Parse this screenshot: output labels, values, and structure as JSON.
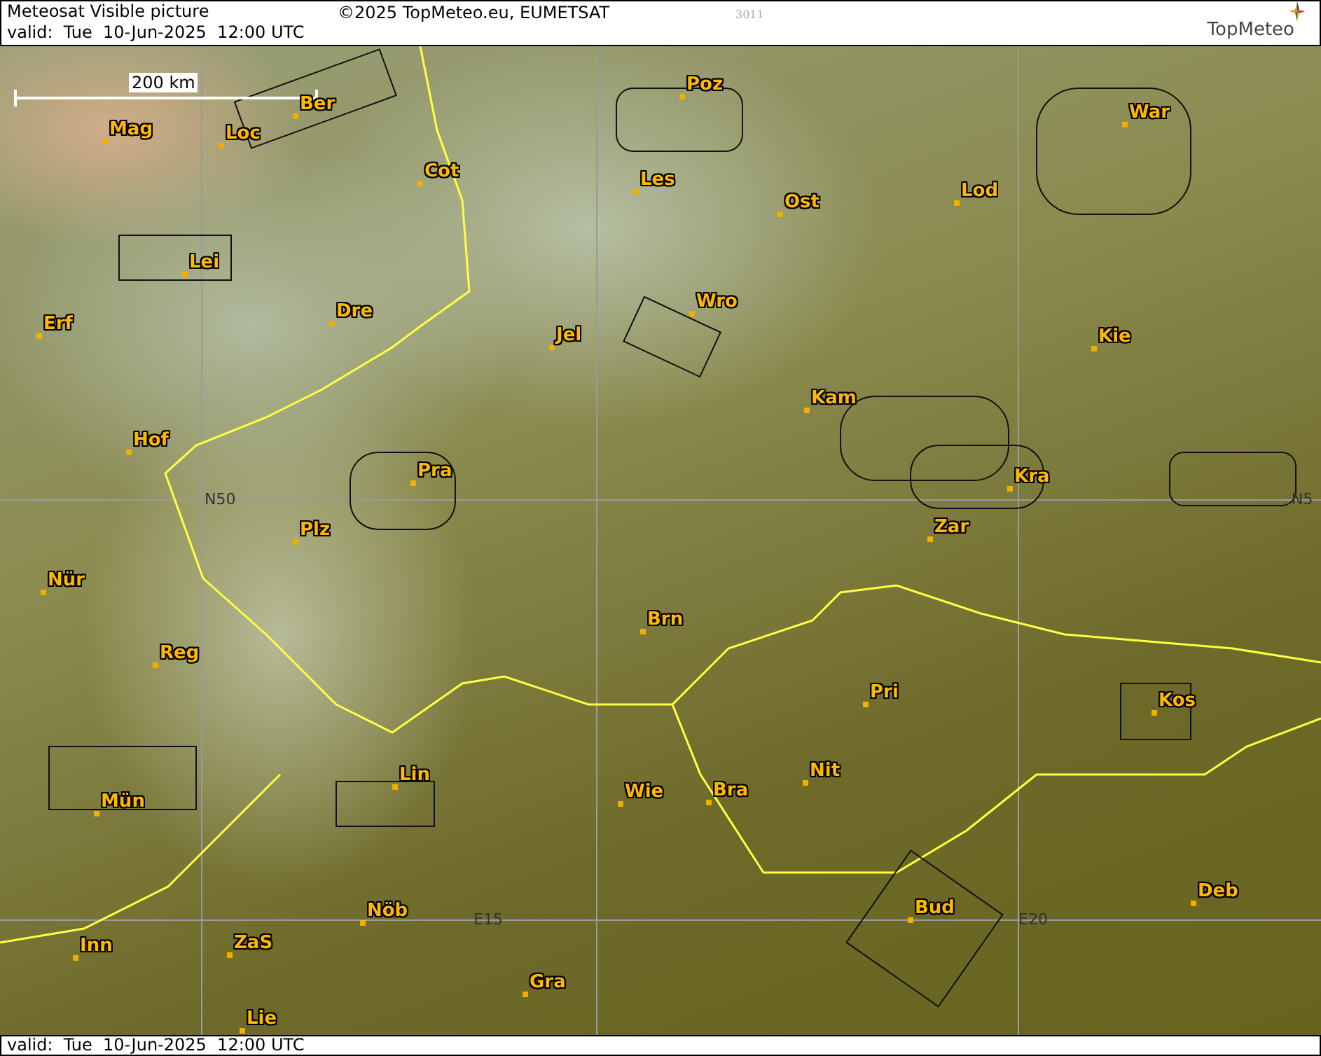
{
  "header": {
    "title": "Meteosat Visible picture",
    "copyright": "©2025 TopMeteo.eu, EUMETSAT",
    "code": "3011",
    "valid": "valid:  Tue  10-Jun-2025  12:00 UTC",
    "logo": "TopMeteo"
  },
  "map": {
    "scale": "200 km",
    "labels": [
      {
        "text": "Ber",
        "kind": "city"
      },
      {
        "text": "Mag",
        "kind": "city"
      },
      {
        "text": "Loc",
        "kind": "city"
      },
      {
        "text": "Cot",
        "kind": "city"
      },
      {
        "text": "Lei",
        "kind": "city"
      },
      {
        "text": "Erf",
        "kind": "city"
      },
      {
        "text": "Dre",
        "kind": "city"
      },
      {
        "text": "Jel",
        "kind": "city"
      },
      {
        "text": "Hof",
        "kind": "city"
      },
      {
        "text": "Pra",
        "kind": "city"
      },
      {
        "text": "Plz",
        "kind": "city"
      },
      {
        "text": "N50",
        "kind": "grid"
      },
      {
        "text": "Poz",
        "kind": "city"
      },
      {
        "text": "Les",
        "kind": "city"
      },
      {
        "text": "Ost",
        "kind": "city"
      },
      {
        "text": "Lod",
        "kind": "city"
      },
      {
        "text": "War",
        "kind": "city"
      },
      {
        "text": "Wro",
        "kind": "city"
      },
      {
        "text": "Kie",
        "kind": "city"
      },
      {
        "text": "Kam",
        "kind": "city"
      },
      {
        "text": "Kra",
        "kind": "city"
      },
      {
        "text": "Zar",
        "kind": "city"
      },
      {
        "text": "N5",
        "kind": "grid"
      },
      {
        "text": "Nür",
        "kind": "city"
      },
      {
        "text": "Reg",
        "kind": "city"
      },
      {
        "text": "Brn",
        "kind": "city"
      },
      {
        "text": "Pri",
        "kind": "city"
      },
      {
        "text": "Kos",
        "kind": "city"
      },
      {
        "text": "Lin",
        "kind": "city"
      },
      {
        "text": "Mün",
        "kind": "city"
      },
      {
        "text": "Wie",
        "kind": "city"
      },
      {
        "text": "Bra",
        "kind": "city"
      },
      {
        "text": "Nit",
        "kind": "city"
      },
      {
        "text": "Nöb",
        "kind": "city"
      },
      {
        "text": "E15",
        "kind": "grid"
      },
      {
        "text": "Bud",
        "kind": "city"
      },
      {
        "text": "E20",
        "kind": "grid"
      },
      {
        "text": "Deb",
        "kind": "city"
      },
      {
        "text": "Inn",
        "kind": "city"
      },
      {
        "text": "ZaS",
        "kind": "city"
      },
      {
        "text": "Gra",
        "kind": "city"
      },
      {
        "text": "Lie",
        "kind": "city"
      }
    ]
  },
  "footer": {
    "valid": "valid:  Tue  10-Jun-2025  12:00 UTC"
  }
}
